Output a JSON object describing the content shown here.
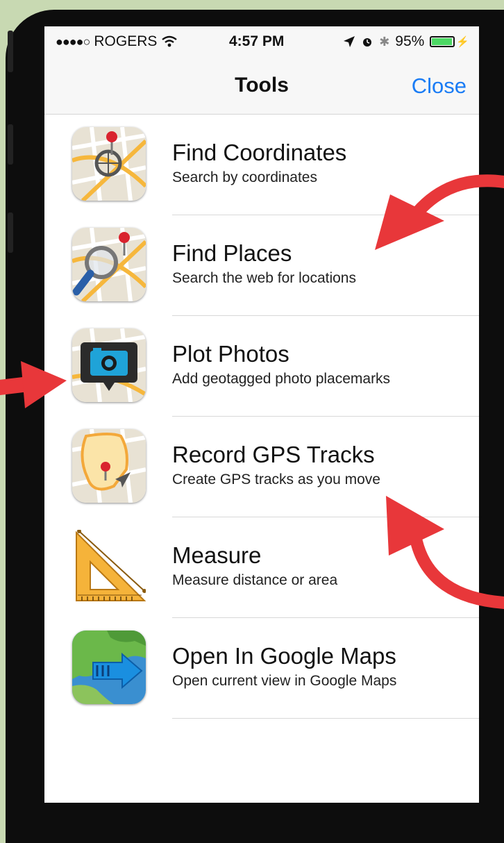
{
  "status_bar": {
    "signal": "●●●●○",
    "carrier": "ROGERS",
    "time": "4:57 PM",
    "battery_percent": "95%",
    "battery_level": 0.95
  },
  "nav": {
    "title": "Tools",
    "close_label": "Close"
  },
  "tools": [
    {
      "title": "Find Coordinates",
      "subtitle": "Search by coordinates",
      "icon": "find-coordinates-icon"
    },
    {
      "title": "Find Places",
      "subtitle": "Search the web for locations",
      "icon": "find-places-icon"
    },
    {
      "title": "Plot Photos",
      "subtitle": "Add geotagged photo placemarks",
      "icon": "plot-photos-icon"
    },
    {
      "title": "Record GPS Tracks",
      "subtitle": "Create GPS tracks as you move",
      "icon": "record-gps-tracks-icon"
    },
    {
      "title": "Measure",
      "subtitle": "Measure distance or area",
      "icon": "measure-icon"
    },
    {
      "title": "Open In Google Maps",
      "subtitle": "Open current view in Google Maps",
      "icon": "google-maps-icon"
    }
  ],
  "colors": {
    "accent": "#1a7cf5",
    "annotation_arrow": "#e8373a",
    "background": "#c8d9b2"
  }
}
